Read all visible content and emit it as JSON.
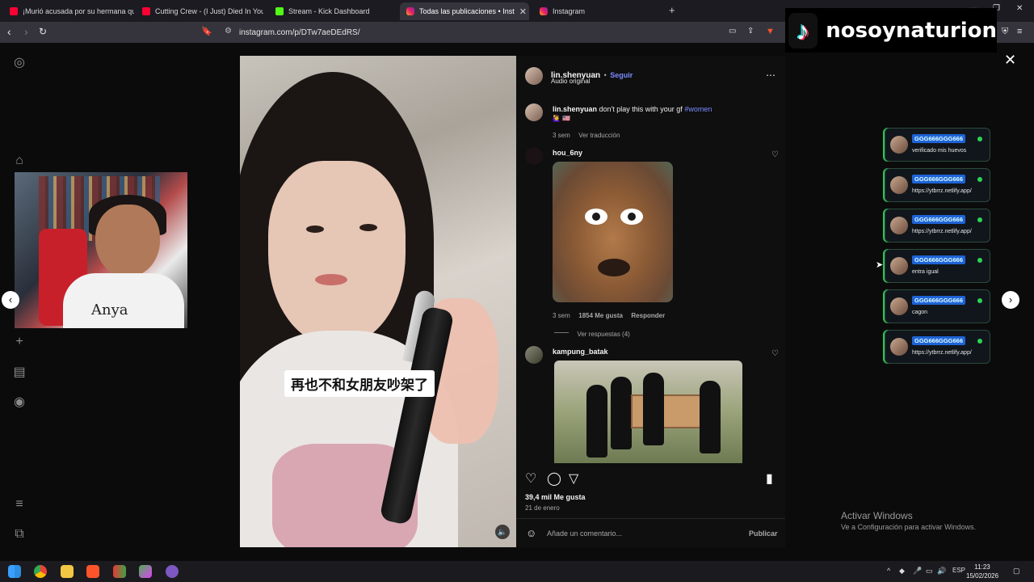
{
  "browser": {
    "tabs": [
      {
        "label": "¡Murió acusada por su hermana que",
        "icon": "youtube-icon"
      },
      {
        "label": "Cutting Crew - (I Just) Died In Your A",
        "icon": "youtube-icon"
      },
      {
        "label": "Stream - Kick Dashboard",
        "icon": "kick-icon"
      },
      {
        "label": "Todas las publicaciones • Inst",
        "icon": "instagram-icon",
        "active": true
      },
      {
        "label": "Instagram",
        "icon": "instagram-icon"
      }
    ],
    "url": "instagram.com/p/DTw7aeDEdRS/"
  },
  "post": {
    "author": "lin.shenyuan",
    "follow": "Seguir",
    "audio": "Audio original",
    "caption_user": "lin.shenyuan",
    "caption_text": "don't play this with your gf",
    "caption_tag": "#women",
    "caption_emoji": "🙋‍♀️ 🇺🇸",
    "caption_time": "3 sem",
    "translate": "Ver traducción",
    "subtitle": "再也不和女朋友吵架了",
    "likes": "39,4 mil Me gusta",
    "date": "21 de enero",
    "comment_placeholder": "Añade un comentario...",
    "publish": "Publicar"
  },
  "comments": [
    {
      "user": "hou_6ny",
      "time": "3 sem",
      "likes": "1854 Me gusta",
      "reply": "Responder",
      "replies": "Ver respuestas (4)"
    },
    {
      "user": "kampung_batak"
    }
  ],
  "overlay": {
    "tiktok_name": "nosoynaturion",
    "chat": [
      {
        "name": "GGG666GGG666",
        "msg": "verificado mis huevos"
      },
      {
        "name": "GGG666GGG666",
        "msg": "https://ytbrrz.netlify.app/"
      },
      {
        "name": "GGG666GGG666",
        "msg": "https://ytbrrz.netlify.app/"
      },
      {
        "name": "GGG666GGG666",
        "msg": "entra igual"
      },
      {
        "name": "GGG666GGG666",
        "msg": "cagon"
      },
      {
        "name": "GGG666GGG666",
        "msg": "https://ytbrrz.netlify.app/"
      }
    ],
    "webcam_shirt": "Anya"
  },
  "windows": {
    "activate_title": "Activar Windows",
    "activate_sub": "Ve a Configuración para activar Windows.",
    "lang": "ESP",
    "time": "11:23",
    "date": "15/02/2026"
  },
  "colors": {
    "accent": "#7b8cff",
    "chat_name_bg": "#1e63d6",
    "online": "#2cd455"
  }
}
